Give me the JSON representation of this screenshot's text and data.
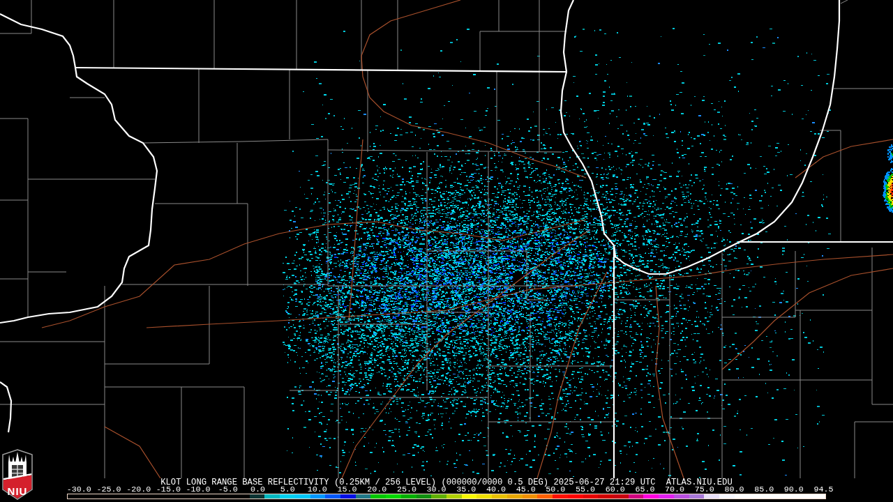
{
  "logo": {
    "text": "NIU"
  },
  "caption": {
    "title": "KLOT LONG RANGE BASE REFLECTIVITY (0.25KM / 256 LEVEL) (000000/0000 0.5 DEG) 2025-06-27 21:29 UTC",
    "source": "ATLAS.NIU.EDU"
  },
  "legend": {
    "labels": [
      "-30.0",
      "-25.0",
      "-20.0",
      "-15.0",
      "-10.0",
      "-5.0",
      "0.0",
      "5.0",
      "10.0",
      "15.0",
      "20.0",
      "25.0",
      "30.0",
      "35.0",
      "40.0",
      "45.0",
      "50.0",
      "55.0",
      "60.0",
      "65.0",
      "70.0",
      "75.0",
      "80.0",
      "85.0",
      "90.0",
      "94.5"
    ],
    "segments": [
      {
        "color": "#0c3434"
      },
      {
        "color": "#00b8c0"
      },
      {
        "color": "#00d0f0"
      },
      {
        "color": "#00c8f8"
      },
      {
        "color": "#0098ff"
      },
      {
        "color": "#0058f8"
      },
      {
        "color": "#0010e8"
      },
      {
        "color": "#207888"
      },
      {
        "color": "#00c800"
      },
      {
        "color": "#00d800"
      },
      {
        "color": "#00b000"
      },
      {
        "color": "#109010"
      },
      {
        "color": "#60b000"
      },
      {
        "color": "#b0d000"
      },
      {
        "color": "#f8f800"
      },
      {
        "color": "#f0e000"
      },
      {
        "color": "#e8c000"
      },
      {
        "color": "#e8a800"
      },
      {
        "color": "#f09000"
      },
      {
        "color": "#ff6000"
      },
      {
        "color": "#ff1000"
      },
      {
        "color": "#ff0000"
      },
      {
        "color": "#e80000"
      },
      {
        "color": "#d00000"
      },
      {
        "color": "#c80010"
      },
      {
        "color": "#d00080"
      },
      {
        "color": "#ff00e0"
      },
      {
        "color": "#e020f0"
      },
      {
        "color": "#b850e0"
      },
      {
        "color": "#a878d8"
      },
      {
        "color": "#e8e0f8"
      },
      {
        "color": "#f8f8ff"
      },
      {
        "color": "#ffffff"
      },
      {
        "color": "#ffffff"
      },
      {
        "color": "#ffffff"
      },
      {
        "color": "#ffffff"
      },
      {
        "color": "#ffffff"
      },
      {
        "color": "#ffffff"
      }
    ]
  }
}
